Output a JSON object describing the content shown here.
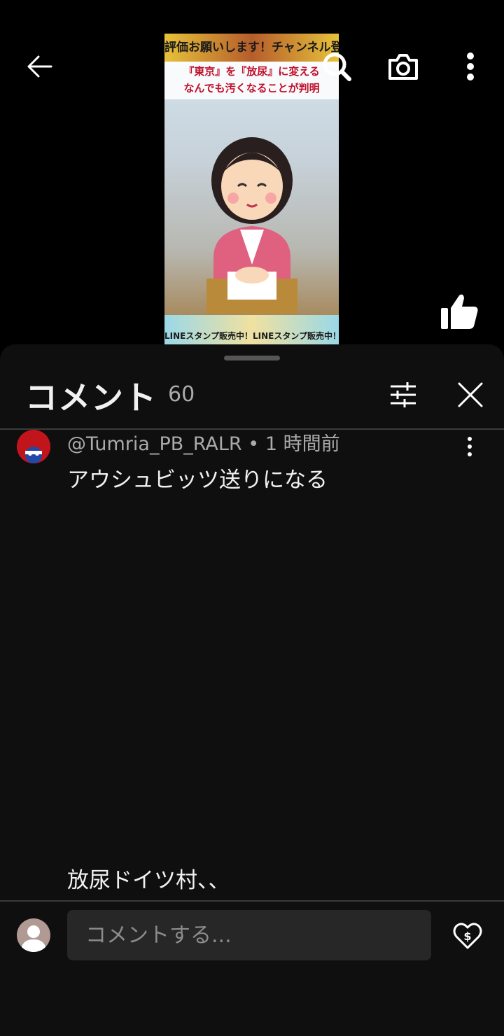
{
  "video": {
    "banner_top": "評価お願いします！チャンネル登録",
    "headline_line1": "『東京』を『放尿』に変える",
    "headline_line2": "なんでも汚くなることが判明",
    "banner_bottom": "LINEスタンプ販売中！LINEスタンプ販売中！LINEスタンプ"
  },
  "top_bar": {
    "back_icon": "arrow-left-icon",
    "search_icon": "search-icon",
    "camera_icon": "camera-icon",
    "more_icon": "more-vert-icon"
  },
  "like": {
    "icon": "thumbs-up-icon"
  },
  "comments": {
    "title": "コメント",
    "count": "60",
    "filter_icon": "sliders-icon",
    "close_icon": "close-icon",
    "items": [
      {
        "author": "@Tumria_PB_RALR",
        "time": "1 時間前",
        "text": "アウシュビッツ送りになる"
      }
    ],
    "partial_text": "放尿ドイツ村、、"
  },
  "composer": {
    "placeholder": "コメントする...",
    "thanks_icon": "super-thanks-icon"
  },
  "colors": {
    "sheet_bg": "#0f0f0f",
    "input_bg": "#272727",
    "meta_text": "#aaaaaa"
  }
}
